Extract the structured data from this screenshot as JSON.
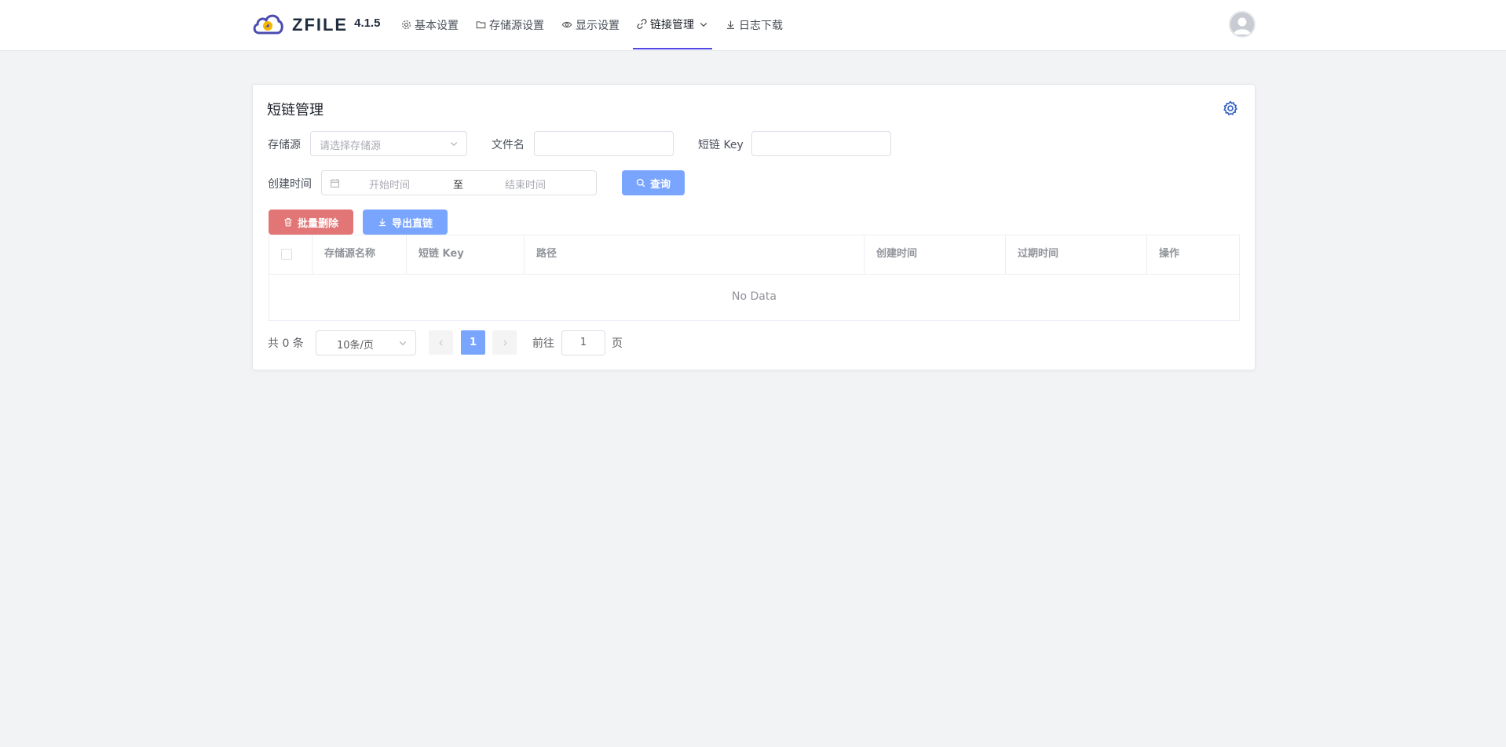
{
  "app": {
    "name": "ZFILE",
    "version": "4.1.5"
  },
  "nav": {
    "items": [
      {
        "label": "基本设置",
        "icon": "gear-icon"
      },
      {
        "label": "存储源设置",
        "icon": "folder-icon"
      },
      {
        "label": "显示设置",
        "icon": "eye-icon"
      },
      {
        "label": "链接管理",
        "icon": "link-icon",
        "active": true
      },
      {
        "label": "日志下载",
        "icon": "download-icon"
      }
    ]
  },
  "page": {
    "title": "短链管理"
  },
  "filters": {
    "storage_label": "存储源",
    "storage_placeholder": "请选择存储源",
    "filename_label": "文件名",
    "filename_value": "",
    "key_label": "短链 Key",
    "key_value": "",
    "created_label": "创建时间",
    "start_placeholder": "开始时间",
    "range_sep": "至",
    "end_placeholder": "结束时间",
    "query_label": "查询"
  },
  "actions": {
    "batch_delete_label": "批量删除",
    "export_label": "导出直链"
  },
  "table": {
    "columns": [
      "存储源名称",
      "短链 Key",
      "路径",
      "创建时间",
      "过期时间",
      "操作"
    ],
    "empty_text": "No Data"
  },
  "pagination": {
    "total_text": "共 0 条",
    "page_size": "10条/页",
    "current_page": "1",
    "goto_label": "前往",
    "goto_value": "1",
    "page_suffix": "页"
  },
  "colors": {
    "accent": "#5046e5",
    "primary_light": "#79a5ff",
    "danger_light": "#e27575",
    "background": "#f2f3f5"
  }
}
